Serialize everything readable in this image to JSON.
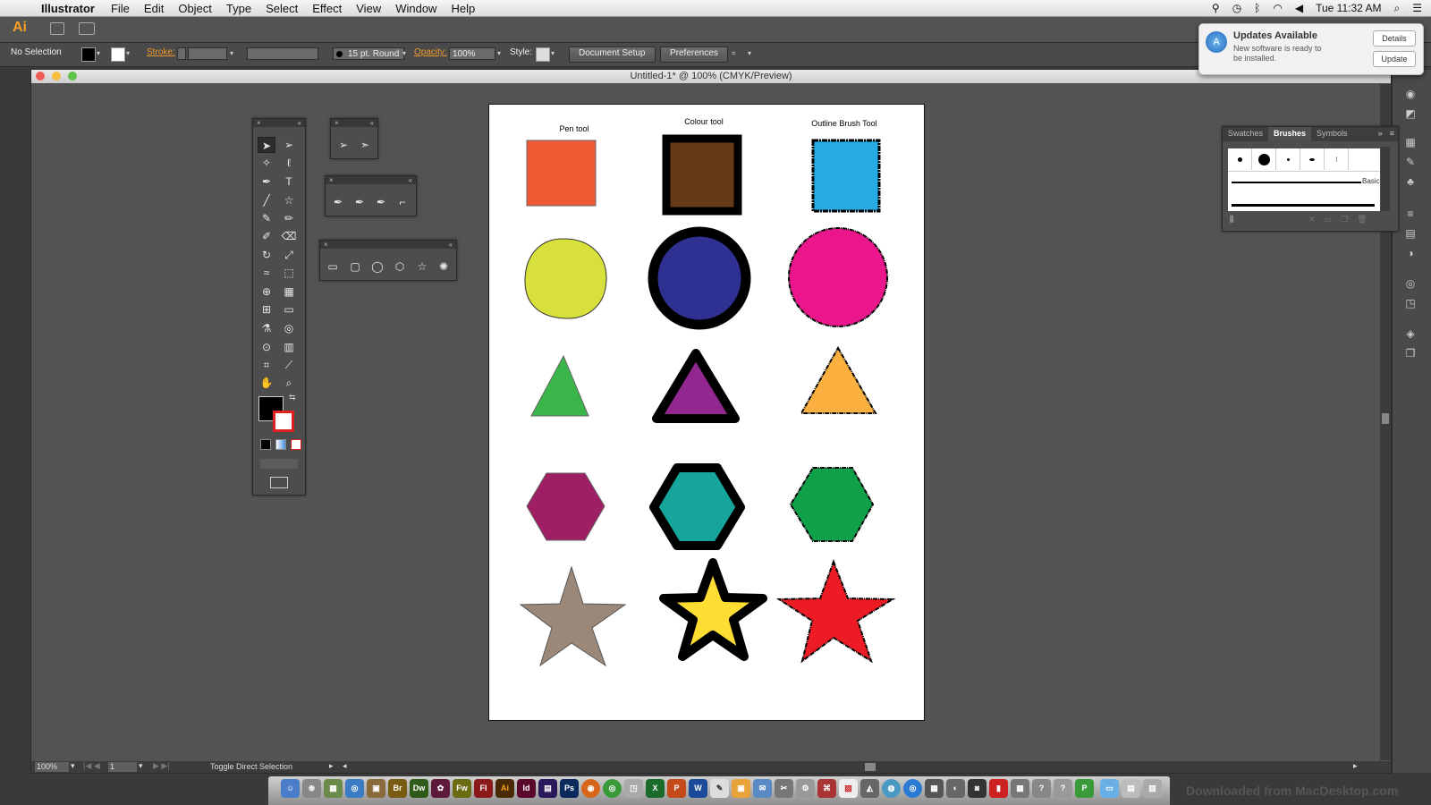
{
  "menubar": {
    "app_name": "Illustrator",
    "items": [
      "File",
      "Edit",
      "Object",
      "Type",
      "Select",
      "Effect",
      "View",
      "Window",
      "Help"
    ],
    "clock": "Tue 11:32 AM"
  },
  "appbar": {
    "logo": "Ai"
  },
  "controlbar": {
    "selection": "No Selection",
    "stroke_label": "Stroke:",
    "brush_size": "15 pt. Round",
    "opacity_label": "Opacity:",
    "opacity_value": "100%",
    "style_label": "Style:",
    "document_setup": "Document Setup",
    "preferences": "Preferences"
  },
  "document": {
    "title": "Untitled-1* @ 100% (CMYK/Preview)",
    "zoom": "100%",
    "page": "1",
    "status": "Toggle Direct Selection"
  },
  "artboard": {
    "labels": {
      "pen": "Pen tool",
      "colour": "Colour tool",
      "outline": "Outline Brush Tool"
    },
    "colors": {
      "orange_square": "#ef5a35",
      "brown_square": "#673a17",
      "blue_square": "#27aae1",
      "yellow_circle": "#d8e03c",
      "navy_circle": "#2e3192",
      "pink_circle": "#ec168c",
      "green_triangle": "#39b54a",
      "purple_triangle": "#92278f",
      "orange_triangle": "#fbb040",
      "magenta_hexagon": "#9e1f63",
      "teal_hexagon": "#16a59b",
      "green_hexagon": "#0fa14a",
      "taupe_star": "#9c8879",
      "yellow_star": "#ffdd33",
      "red_star": "#ed1c24"
    }
  },
  "brushes_panel": {
    "tabs": [
      "Swatches",
      "Brushes",
      "Symbols"
    ],
    "active_tab": "Brushes",
    "basic_label": "Basic"
  },
  "notification": {
    "title": "Updates Available",
    "body": "New software is ready to be installed.",
    "details": "Details",
    "update": "Update"
  },
  "watermark": "Downloaded from MacDesktop.com"
}
